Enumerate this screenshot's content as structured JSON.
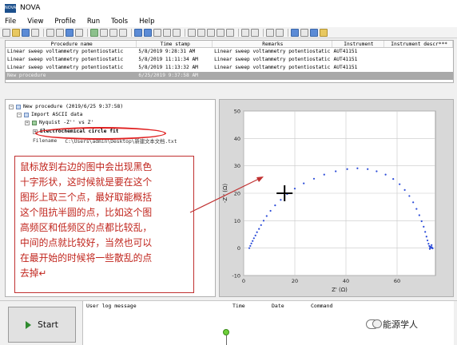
{
  "window": {
    "title": "NOVA",
    "icon": "nova-app-icon",
    "icon_text": "NOVA"
  },
  "menu": [
    "File",
    "View",
    "Profile",
    "Run",
    "Tools",
    "Help"
  ],
  "procedures": {
    "columns": [
      "Procedure name",
      "Time stamp",
      "Remarks",
      "Instrument",
      "Instrument descr***"
    ],
    "rows": [
      [
        "Linear sweep voltammetry potentiostatic",
        "5/8/2019 9:28:31 AM",
        "Linear sweep voltammetry potentiostatic",
        "AUT41151",
        ""
      ],
      [
        "Linear sweep voltammetry potentiostatic",
        "5/8/2019 11:11:34 AM",
        "Linear sweep voltammetry potentiostatic",
        "AUT41151",
        ""
      ],
      [
        "Linear sweep voltammetry potentiostatic",
        "5/8/2019 11:13:32 AM",
        "Linear sweep voltammetry potentiostatic",
        "AUT41151",
        ""
      ],
      [
        "New procedure",
        "6/25/2019 9:37:58 AM",
        "",
        "",
        ""
      ]
    ]
  },
  "tree": {
    "root": "New procedure (2019/6/25 9:37:58)",
    "import": "Import ASCII data",
    "nyquist": "Nyquist -Z'' vs Z'",
    "fit": "Electrochemical circle fit",
    "filename_label": "Filename",
    "filename_value": "C:\\Users\\admin\\Desktop\\新建文本文档.txt"
  },
  "annotation": {
    "lines": [
      "鼠标放到右边的图中会出现黑色",
      "十字形状，这时候就是要在这个",
      "图形上取三个点，最好取能概括",
      "这个阻抗半圆的点，比如这个图",
      "高频区和低频区的点都比较乱，",
      "中间的点就比较好，当然也可以",
      "在最开始的时候将一些散乱的点",
      "去掉↵"
    ]
  },
  "chart_data": {
    "type": "scatter",
    "xlabel": "Z' (Ω)",
    "ylabel": "-Z'' (Ω)",
    "xlim": [
      0,
      75
    ],
    "ylim": [
      -10,
      50
    ],
    "xticks": [
      0,
      20,
      40,
      60
    ],
    "yticks": [
      -10,
      0,
      10,
      20,
      30,
      40,
      50
    ],
    "grid": true,
    "series": [
      {
        "x": [
          2.2,
          2.6,
          3.0,
          3.5,
          4.0,
          4.6,
          5.2,
          6.0,
          6.8,
          7.8,
          9.0,
          10.5,
          12.3,
          14.5,
          17.0,
          20.0,
          23.5,
          27.5,
          31.5,
          36.0,
          40.5,
          44.5,
          48.5,
          52.0,
          55.5,
          58.5,
          61.0,
          63.0,
          64.8,
          66.3,
          67.6,
          68.7,
          69.6,
          70.4,
          71.0,
          71.5,
          71.9,
          72.3,
          72.6,
          72.9,
          73.2,
          73.5,
          73.3,
          72.8,
          73.6,
          73.9
        ],
        "y": [
          0.0,
          0.8,
          1.7,
          2.6,
          3.6,
          4.6,
          5.8,
          7.0,
          8.4,
          10.0,
          11.7,
          13.6,
          15.6,
          17.6,
          19.7,
          21.7,
          23.6,
          25.3,
          26.8,
          28.0,
          28.8,
          29.1,
          28.8,
          28.0,
          26.8,
          25.2,
          23.3,
          21.2,
          19.0,
          16.7,
          14.3,
          12.0,
          9.8,
          7.8,
          5.9,
          4.2,
          2.8,
          1.6,
          0.8,
          0.3,
          0.5,
          1.1,
          0.1,
          -0.3,
          0.3,
          -0.1
        ]
      }
    ],
    "cursor": {
      "x": 16,
      "y": 20
    }
  },
  "start_button": {
    "label": "Start"
  },
  "log": {
    "columns": [
      "User log message",
      "Time",
      "Date",
      "Command"
    ]
  },
  "watermark": {
    "text": "能源学人"
  },
  "colors": {
    "annotation_red": "#c0241c",
    "selection_gray": "#a9a9a9",
    "point_blue": "#2a4ad8",
    "led_green": "#6ecf3a"
  }
}
